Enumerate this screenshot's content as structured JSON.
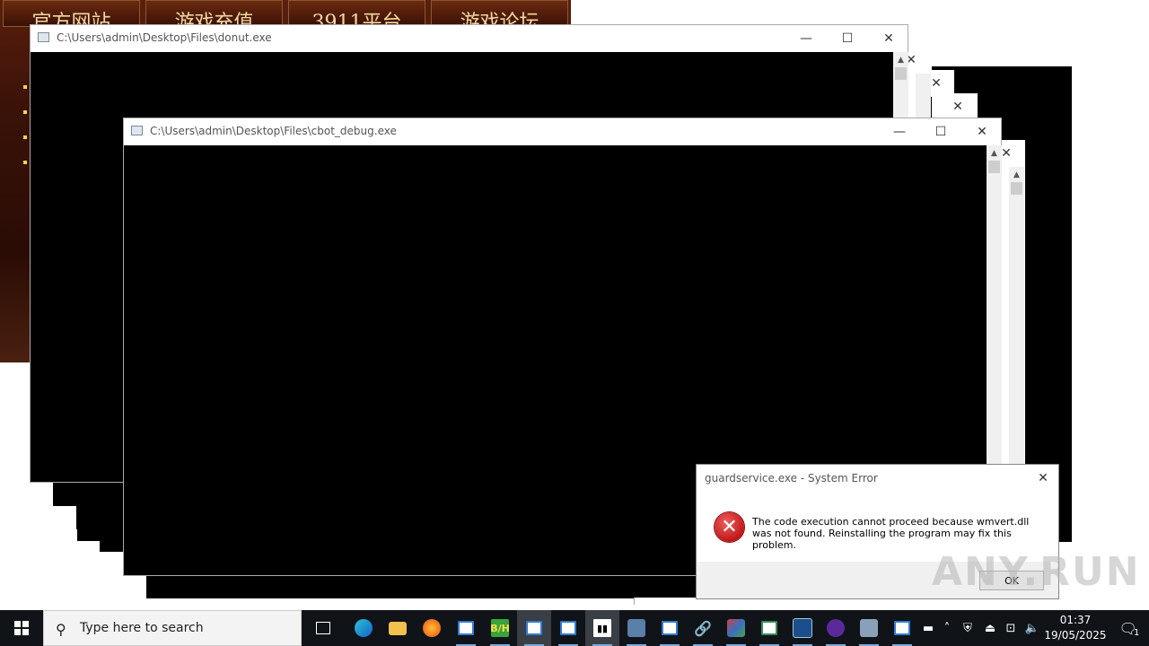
{
  "banner": {
    "tabs": [
      "官方网站",
      "游戏充值",
      "3911平台",
      "游戏论坛"
    ]
  },
  "windows": {
    "donut": {
      "title": "C:\\Users\\admin\\Desktop\\Files\\donut.exe"
    },
    "cbot": {
      "title": "C:\\Users\\admin\\Desktop\\Files\\cbot_debug.exe"
    },
    "controls": {
      "minimize": "—",
      "maximize": "☐",
      "close": "✕"
    }
  },
  "dialog": {
    "title": "guardservice.exe - System Error",
    "message": "The code execution cannot proceed because wmvert.dll was not found. Reinstalling the program may fix this problem.",
    "ok_label": "OK",
    "close": "✕"
  },
  "watermark": "ANY.RUN",
  "taskbar": {
    "search_placeholder": "Type here to search",
    "time": "01:37",
    "date": "19/05/2025",
    "notification_count": "1",
    "icons": [
      "task-view-icon",
      "edge-icon",
      "file-explorer-icon",
      "firefox-icon",
      "app-window-icon",
      "bh-app-icon",
      "app-window-icon",
      "app-window-icon",
      "binary-app-icon",
      "network-tool-icon",
      "app-window-icon",
      "link-icon",
      "installer-icon",
      "app-window-icon",
      "monitor-icon",
      "purple-app-icon",
      "package-icon",
      "app-window-icon"
    ],
    "tray_icons": [
      "tray-app-icon",
      "chevron-up-icon",
      "shield-icon",
      "usb-icon",
      "network-icon",
      "volume-icon"
    ]
  },
  "colors": {
    "taskbar_bg": "#101418",
    "error_red": "#c01818",
    "console_bg": "#000000"
  }
}
